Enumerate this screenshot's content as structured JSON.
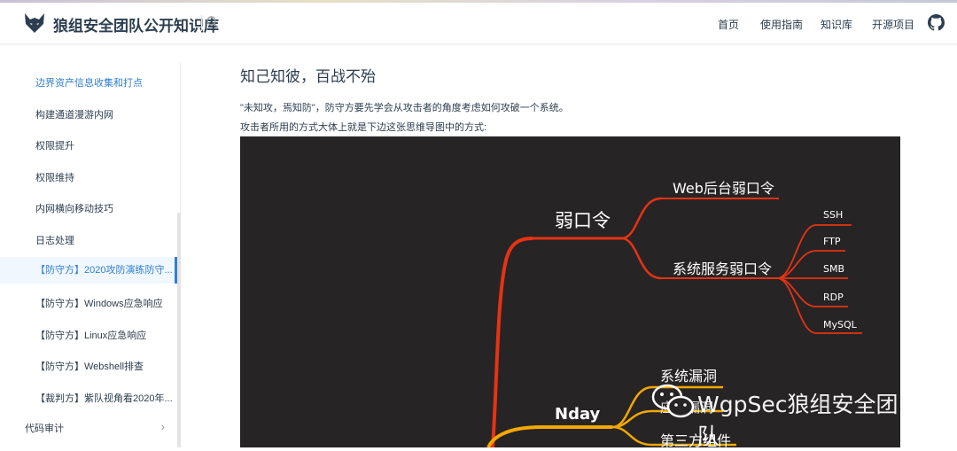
{
  "header": {
    "site_title": "狼组安全团队公开知识库",
    "nav": [
      "首页",
      "使用指南",
      "知识库",
      "开源项目"
    ]
  },
  "sidebar": {
    "items": [
      {
        "label": "边界资产信息收集和打点"
      },
      {
        "label": "构建通道漫游内网"
      },
      {
        "label": "权限提升"
      },
      {
        "label": "权限维持"
      },
      {
        "label": "内网横向移动技巧"
      },
      {
        "label": "日志处理"
      },
      {
        "label": "【防守方】2020攻防演练防守..."
      },
      {
        "label": "【防守方】Windows应急响应"
      },
      {
        "label": "【防守方】Linux应急响应"
      },
      {
        "label": "【防守方】Webshell排查"
      },
      {
        "label": "【裁判方】紫队视角看2020年..."
      }
    ],
    "group": "代码审计"
  },
  "content": {
    "heading": "知己知彼，百战不殆",
    "p1": "\"未知攻，焉知防\"，防守方要先学会从攻击者的角度考虑如何攻破一个系统。",
    "p2": "攻击者所用的方式大体上就是下边这张思维导图中的方式:"
  },
  "mindmap": {
    "weak_pw": "弱口令",
    "web_admin": "Web后台弱口令",
    "sys_service": "系统服务弱口令",
    "services": [
      "SSH",
      "FTP",
      "SMB",
      "RDP",
      "MySQL"
    ],
    "nday": "Nday",
    "sys_vuln": "系统漏洞",
    "app_vuln": "应用漏洞",
    "third_party": "第三方组件",
    "watermark": "WgpSec狼组安全团队"
  },
  "colors": {
    "red_branch": "#e63312",
    "orange_branch": "#f5a800",
    "mindmap_bg": "#272426",
    "active_link": "#3080d0"
  }
}
